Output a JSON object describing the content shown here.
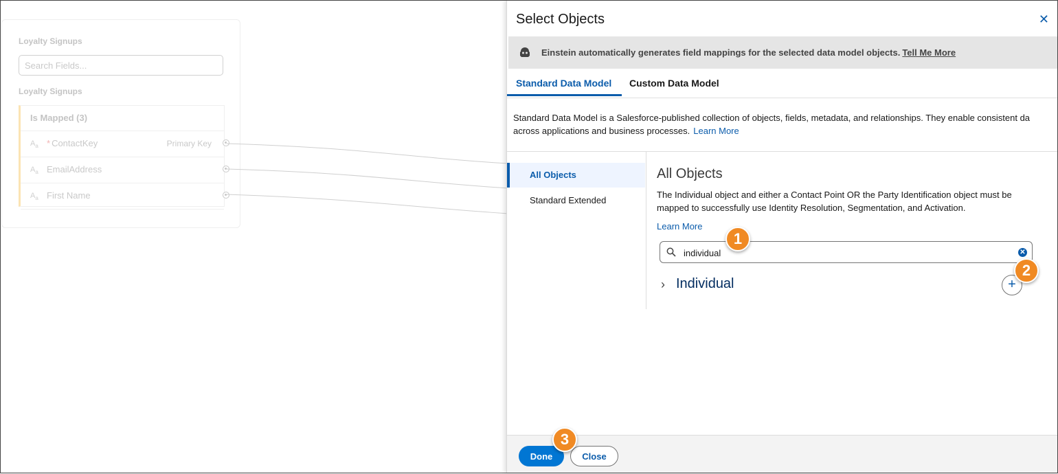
{
  "background": {
    "card_title": "Loyalty Signups",
    "search_placeholder": "Search Fields...",
    "section_title": "Loyalty Signups",
    "group_label": "Is Mapped (3)",
    "fields": [
      {
        "type_icon": "A",
        "type_sub": "a",
        "required": "*",
        "name": "ContactKey",
        "tag": "Primary Key"
      },
      {
        "type_icon": "A",
        "type_sub": "a",
        "required": "",
        "name": "EmailAddress",
        "tag": ""
      },
      {
        "type_icon": "A",
        "type_sub": "a",
        "required": "",
        "name": "First Name",
        "tag": ""
      }
    ]
  },
  "modal": {
    "title": "Select Objects",
    "close_glyph": "✕",
    "banner": {
      "text": "Einstein automatically generates field mappings for the selected data model objects.",
      "link": "Tell Me More"
    },
    "tabs": [
      {
        "label": "Standard Data Model",
        "active": true
      },
      {
        "label": "Custom Data Model",
        "active": false
      }
    ],
    "description": {
      "line1": "Standard Data Model is a Salesforce-published collection of objects, fields, metadata, and relationships. They enable consistent da",
      "line2": "across applications and business processes.",
      "link": "Learn More"
    },
    "nav": [
      {
        "label": "All Objects",
        "active": true
      },
      {
        "label": "Standard Extended",
        "active": false
      }
    ],
    "content": {
      "heading": "All Objects",
      "text": "The Individual object and either a Contact Point OR the Party Identification object must be mapped to successfully use Identity Resolution, Segmentation, and Activation.",
      "link": "Learn More"
    },
    "search": {
      "value": "individual",
      "clear_glyph": "✕"
    },
    "results": [
      {
        "name": "Individual",
        "chevron": "›",
        "add_glyph": "+"
      }
    ],
    "footer": {
      "done": "Done",
      "close": "Close"
    }
  },
  "callouts": [
    "1",
    "2",
    "3"
  ],
  "colors": {
    "brand_blue": "#0176d3",
    "link_blue": "#0b5cab",
    "callout_orange": "#f08a24",
    "banner_gray": "#e5e5e5"
  }
}
